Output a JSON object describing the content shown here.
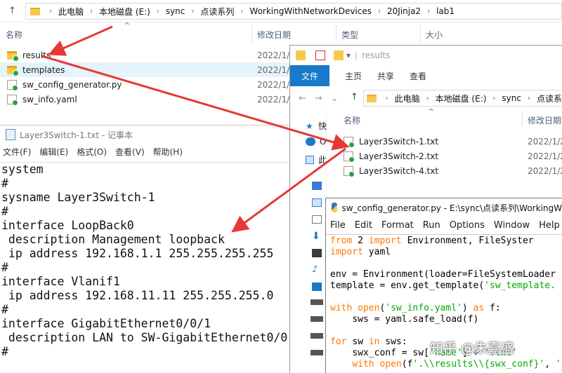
{
  "explorer_main": {
    "breadcrumb": [
      "此电脑",
      "本地磁盘 (E:)",
      "sync",
      "点读系列",
      "WorkingWithNetworkDevices",
      "20Jinja2",
      "lab1"
    ],
    "columns": {
      "name": "名称",
      "modified": "修改日期",
      "type": "类型",
      "size": "大小"
    },
    "files": [
      {
        "name": "results",
        "kind": "folder",
        "date": "2022/1/"
      },
      {
        "name": "templates",
        "kind": "folder",
        "date": "2022/1/"
      },
      {
        "name": "sw_config_generator.py",
        "kind": "file",
        "date": "2022/1/"
      },
      {
        "name": "sw_info.yaml",
        "kind": "file",
        "date": "2022/1/"
      }
    ]
  },
  "explorer_results": {
    "title": "results",
    "ribbon": {
      "file": "文件",
      "home": "主页",
      "share": "共享",
      "view": "查看"
    },
    "breadcrumb": [
      "此电脑",
      "本地磁盘 (E:)",
      "sync",
      "点读系"
    ],
    "columns": {
      "name": "名称",
      "modified": "修改日期"
    },
    "nav": [
      "快",
      "O",
      "此"
    ],
    "files": [
      {
        "name": "Layer3Switch-1.txt",
        "date": "2022/1/2"
      },
      {
        "name": "Layer3Switch-2.txt",
        "date": "2022/1/2"
      },
      {
        "name": "Layer3Switch-4.txt",
        "date": "2022/1/2"
      }
    ]
  },
  "notepad": {
    "title": "Layer3Switch-1.txt - 记事本",
    "menu": [
      "文件(F)",
      "编辑(E)",
      "格式(O)",
      "查看(V)",
      "帮助(H)"
    ],
    "lines": [
      "system",
      "#",
      "sysname Layer3Switch-1",
      "#",
      "interface LoopBack0",
      " description Management loopback",
      " ip address 192.168.1.1 255.255.255.255",
      "#",
      "interface Vlanif1",
      " ip address 192.168.11.11 255.255.255.0",
      "#",
      "interface GigabitEthernet0/0/1",
      " description LAN to SW-GigabitEthernet0/0",
      "#"
    ]
  },
  "idle": {
    "title": "sw_config_generator.py - E:\\sync\\点读系列\\WorkingW",
    "menu": [
      "File",
      "Edit",
      "Format",
      "Run",
      "Options",
      "Window",
      "Help"
    ],
    "code": [
      "from jinja2 import Environment, FileSyster",
      "import yaml",
      "",
      "env = Environment(loader=FileSystemLoader",
      "template = env.get_template('sw_template.",
      "",
      "with open('sw_info.yaml') as f:",
      "    sws = yaml.safe_load(f)",
      "",
      "for sw in sws:",
      "    swx_conf = sw['name'] + '.txt'",
      "    with open(f'.\\\\results\\\\{swx_conf}', '"
    ]
  },
  "watermark": "知乎 @朱嘉盛",
  "colors": {
    "ribbon_file": "#1979ca",
    "selected_row": "#e5f3fb",
    "arrow": "#e53935",
    "keyword": "#ff7700",
    "string": "#00aa00",
    "sync_badge": "#2ea043"
  }
}
